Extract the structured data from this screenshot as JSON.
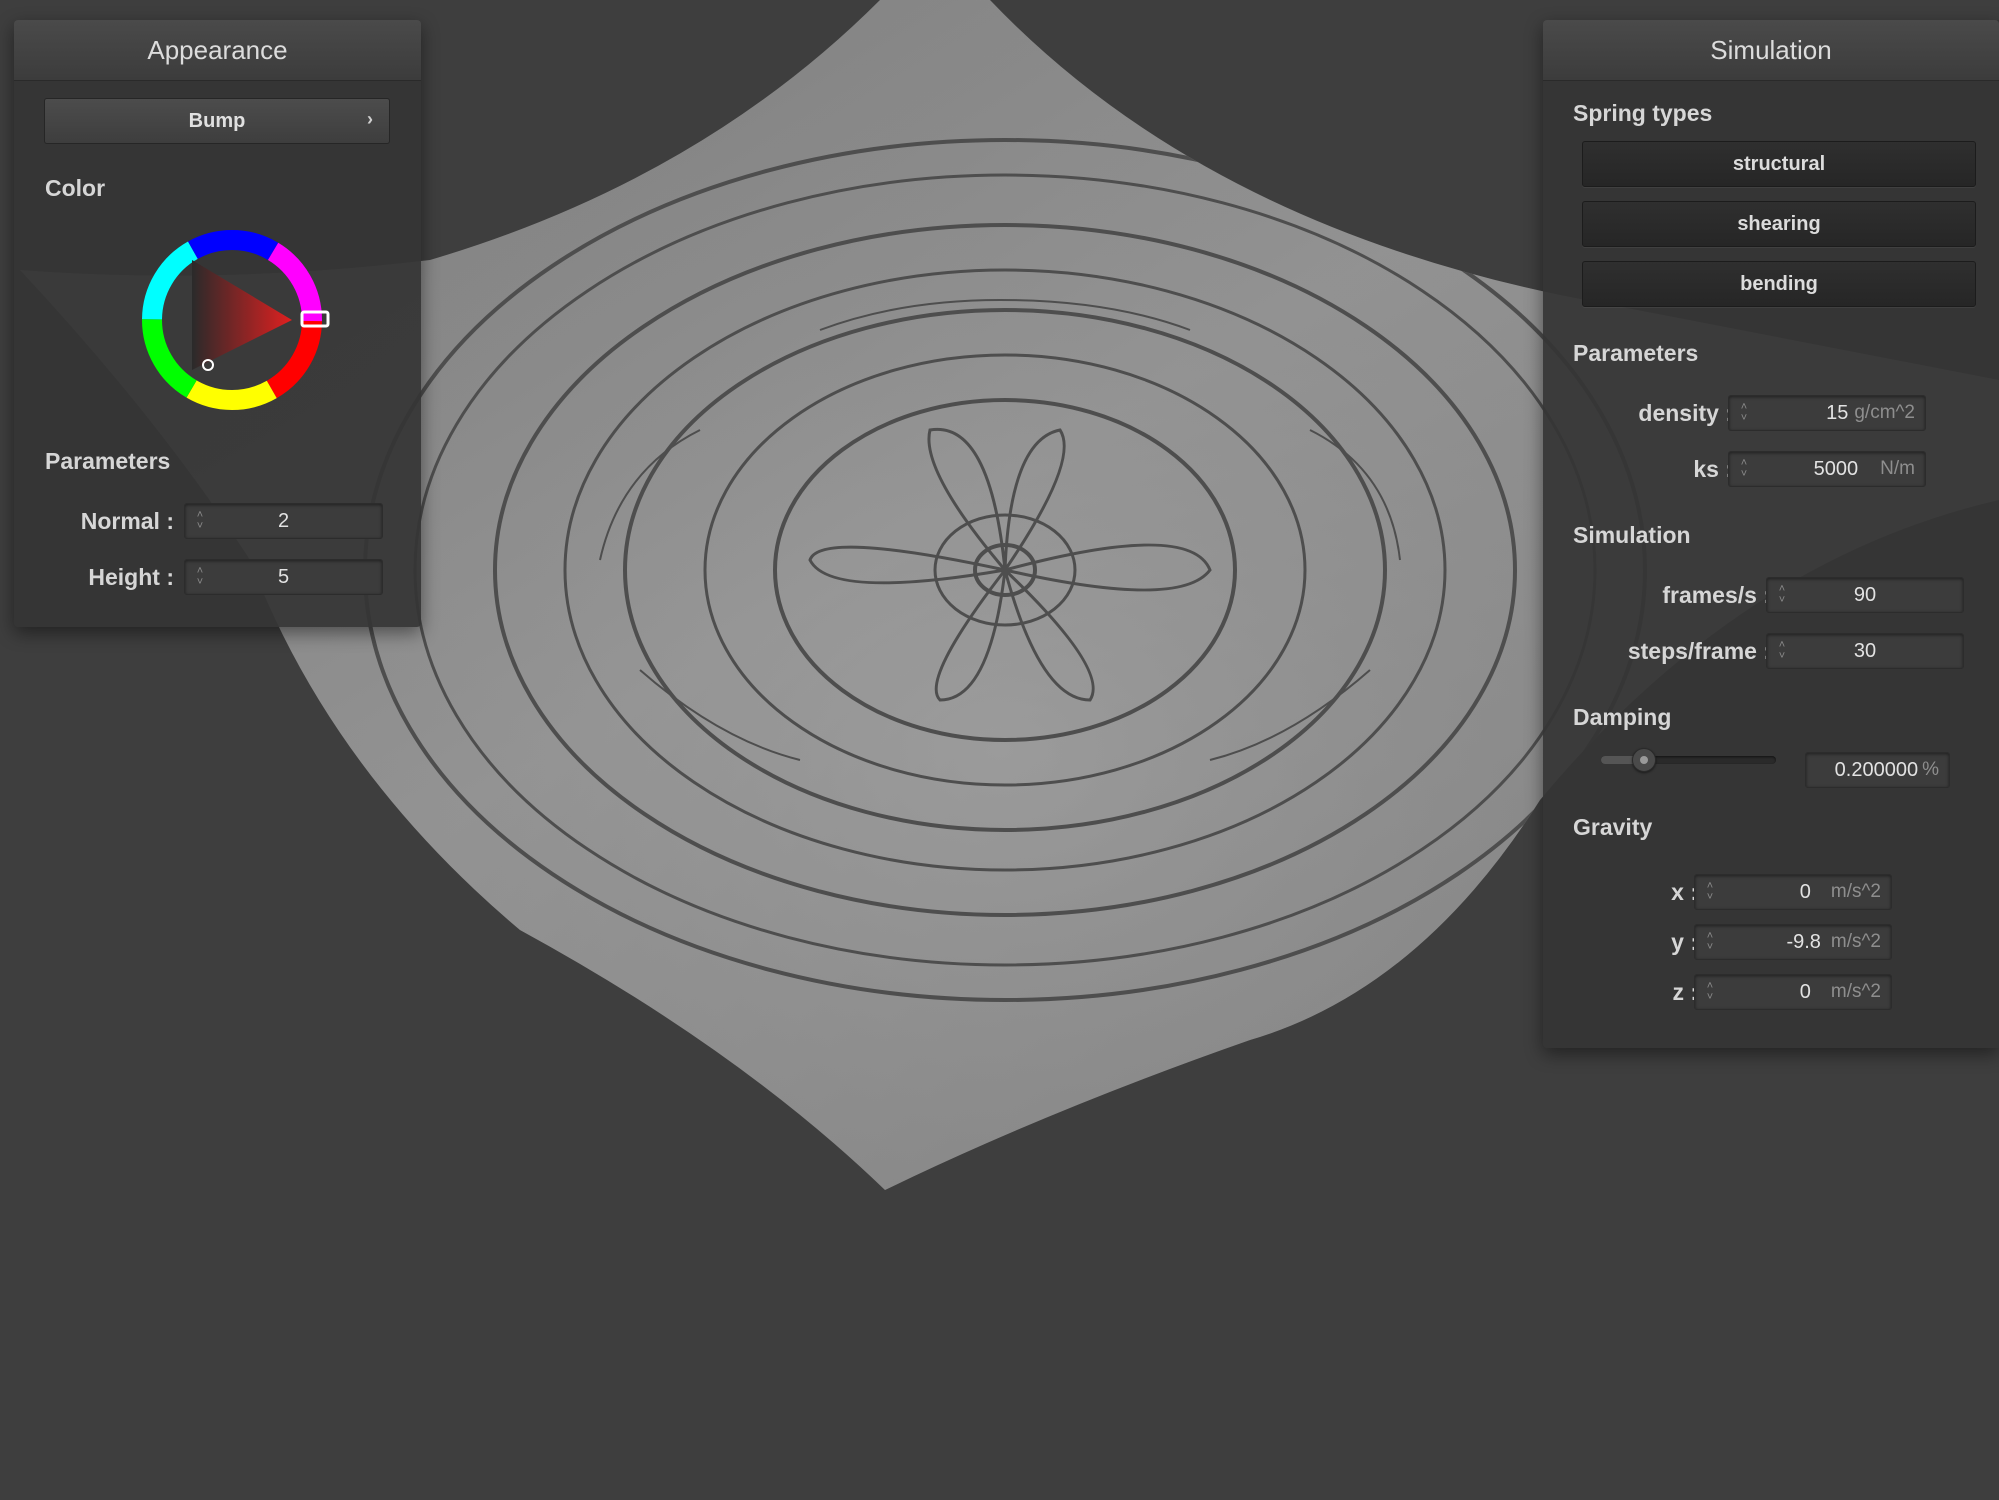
{
  "appearance": {
    "title": "Appearance",
    "mode_dropdown": "Bump",
    "color_label": "Color",
    "color_value": "#c21d1d",
    "parameters_label": "Parameters",
    "normal": {
      "label": "Normal :",
      "value": "2"
    },
    "height": {
      "label": "Height :",
      "value": "5"
    }
  },
  "simulation": {
    "title": "Simulation",
    "spring_types_label": "Spring types",
    "spring_buttons": [
      "structural",
      "shearing",
      "bending"
    ],
    "parameters_label": "Parameters",
    "density": {
      "label": "density :",
      "value": "15",
      "unit": "g/cm^2"
    },
    "ks": {
      "label": "ks :",
      "value": "5000",
      "unit": "N/m"
    },
    "simulation_label": "Simulation",
    "frames_per_s": {
      "label": "frames/s :",
      "value": "90"
    },
    "steps_per_frame": {
      "label": "steps/frame :",
      "value": "30"
    },
    "damping_label": "Damping",
    "damping": {
      "value": "0.200000",
      "unit": "%",
      "slider_fraction": 0.2
    },
    "gravity_label": "Gravity",
    "gravity": [
      {
        "label": "x :",
        "value": "0",
        "unit": "m/s^2"
      },
      {
        "label": "y :",
        "value": "-9.8",
        "unit": "m/s^2"
      },
      {
        "label": "z :",
        "value": "0",
        "unit": "m/s^2"
      }
    ]
  },
  "viewport": {
    "description_icon": "cloth-mesh-mandala"
  }
}
